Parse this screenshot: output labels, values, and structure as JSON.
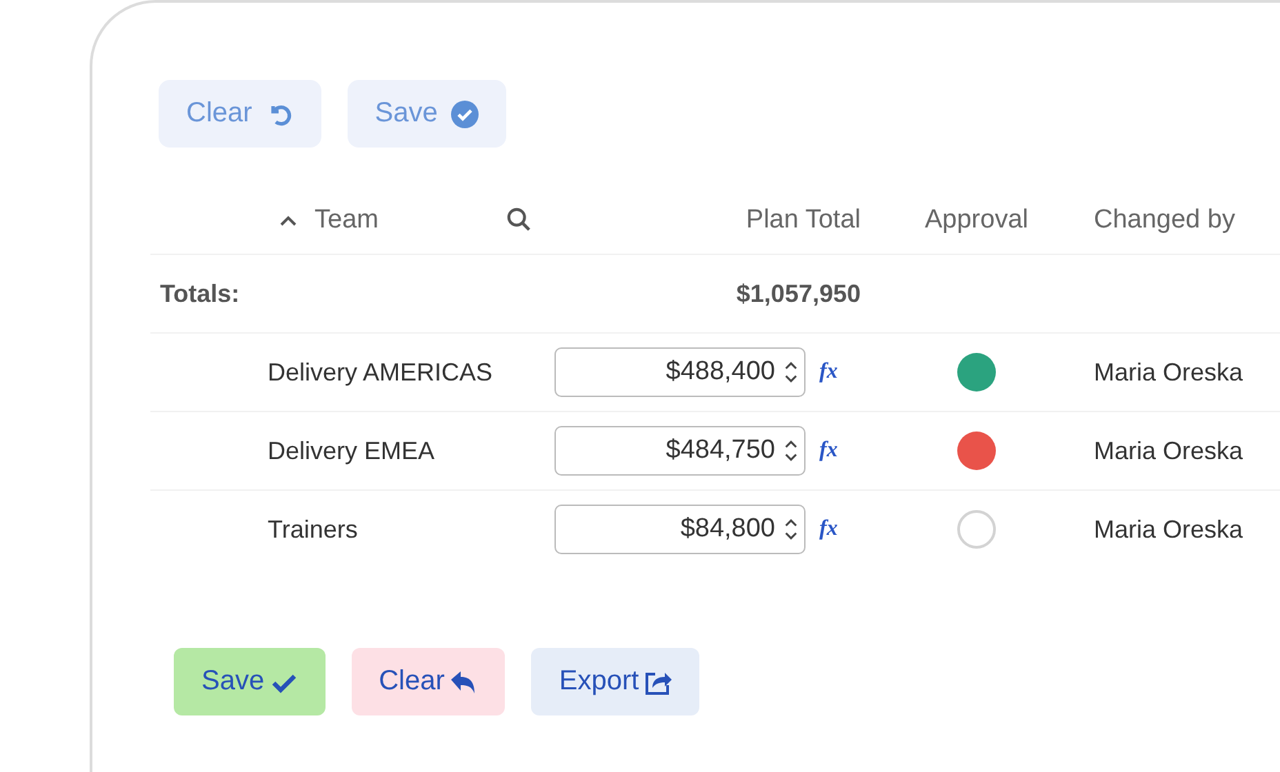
{
  "top_buttons": [
    {
      "label": "Clear"
    },
    {
      "label": "Save"
    }
  ],
  "table": {
    "columns": [
      {
        "label": "Team",
        "sort_ascending": true
      },
      {
        "label": "Plan Total"
      },
      {
        "label": "Approval"
      },
      {
        "label": "Changed by"
      }
    ],
    "totals": {
      "label": "Totals:",
      "plan_total": "$1,057,950"
    },
    "rows": [
      {
        "team": "Delivery AMERICAS",
        "plan_total": "$488,400",
        "formula": "fx",
        "color": "#2ba37f",
        "changed_by": "Maria Oreska"
      },
      {
        "team": "Delivery EMEA",
        "plan_total": "$484,750",
        "formula": "fx",
        "color": "#e9534a",
        "changed_by": "Maria Oreska"
      },
      {
        "team": "Trainers",
        "plan_total": "$84,800",
        "formula": "fx",
        "changed_by": "Maria Oreska"
      }
    ]
  },
  "bottom_buttons": [
    {
      "label": "Save",
      "kind": "save"
    },
    {
      "label": "Clear",
      "kind": "clear"
    },
    {
      "label": "Export",
      "kind": "export"
    }
  ]
}
